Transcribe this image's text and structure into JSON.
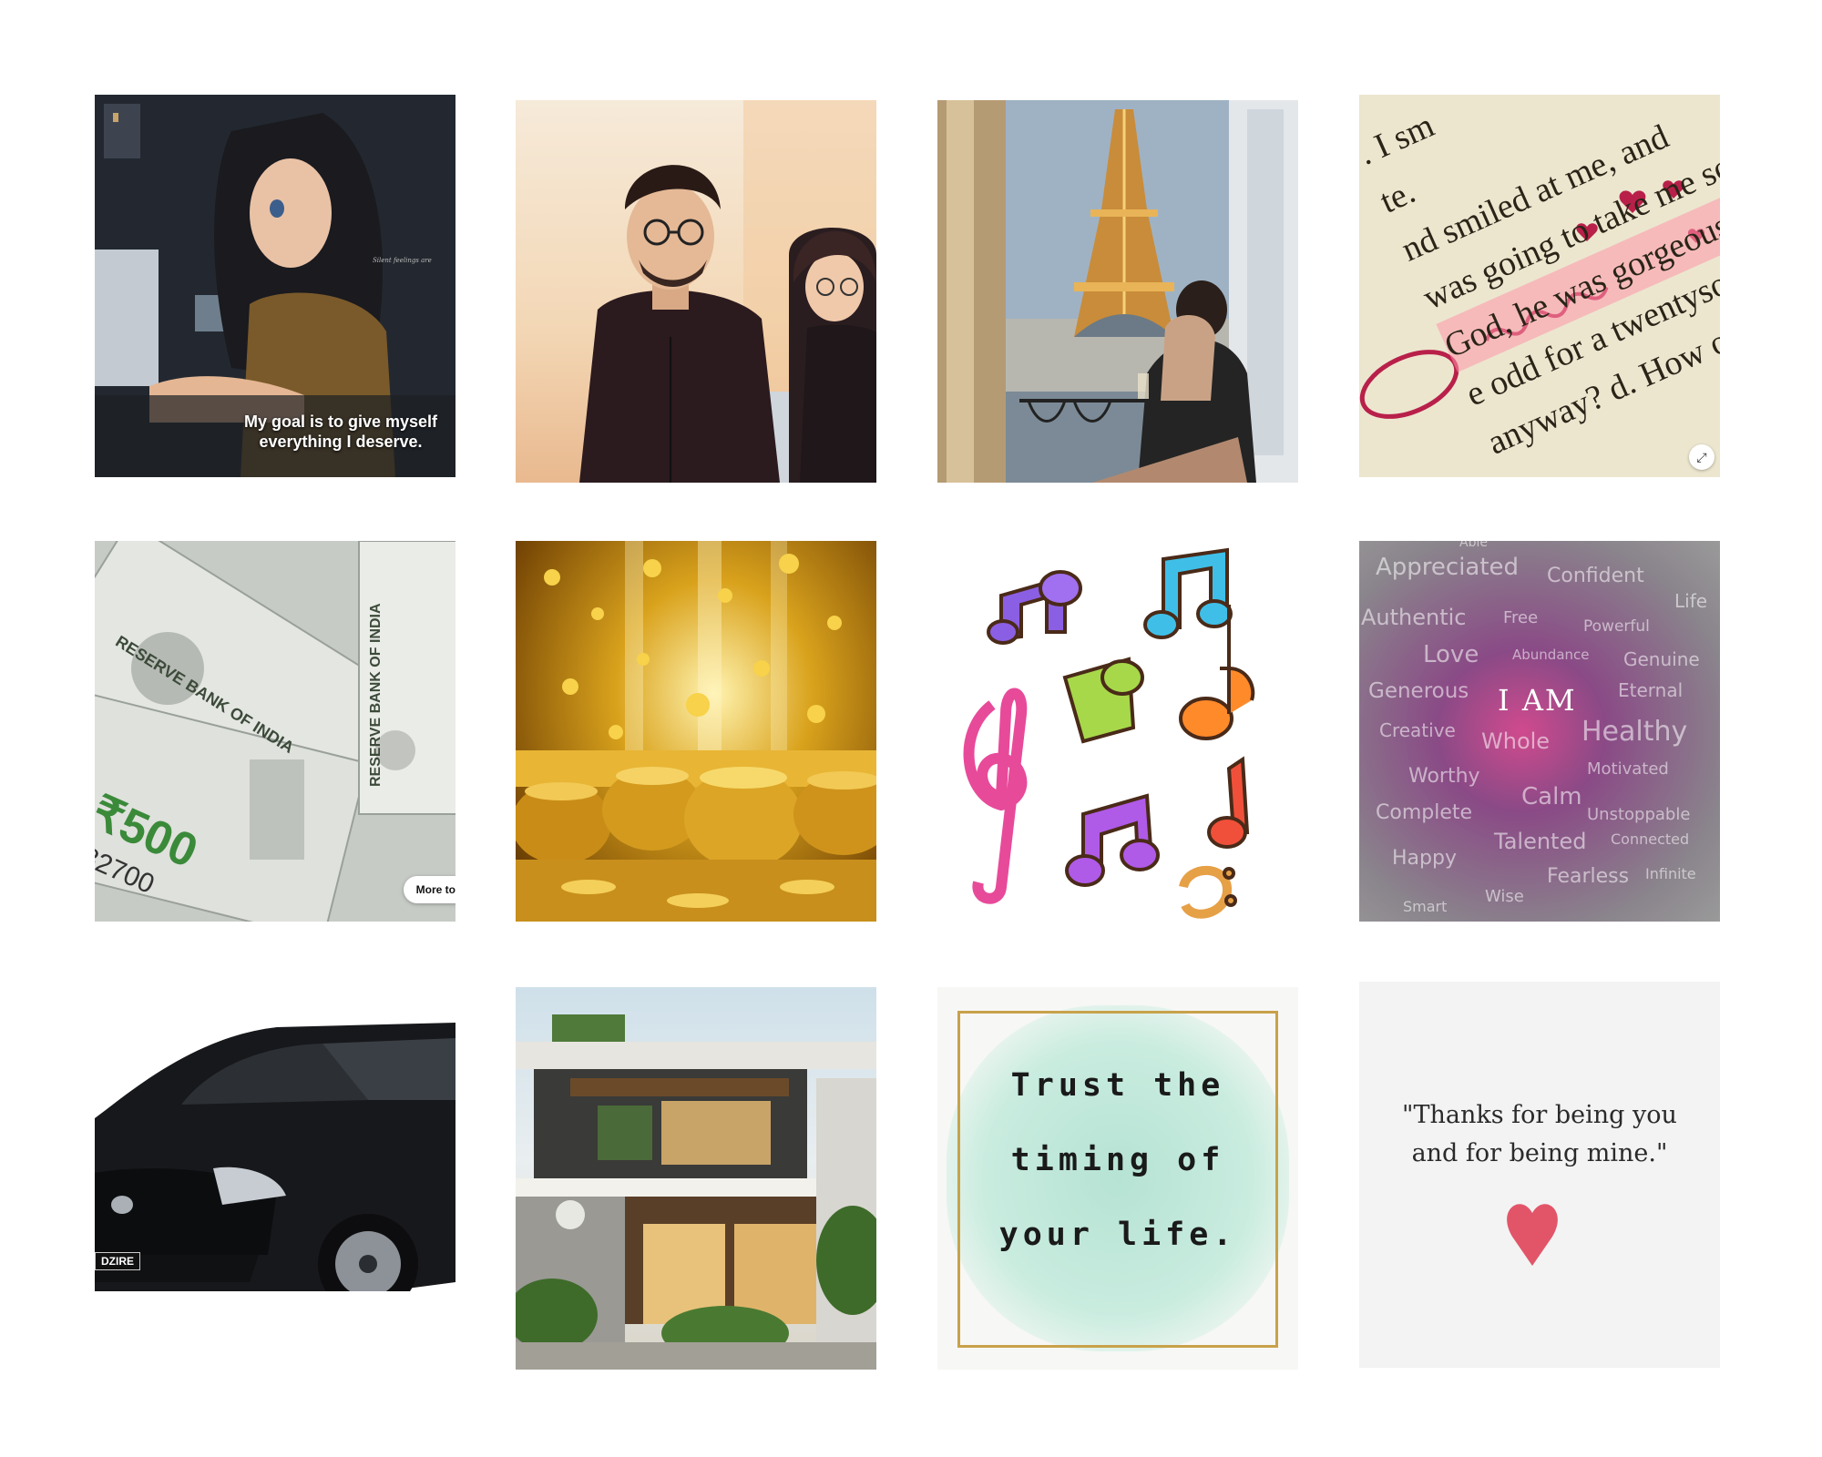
{
  "tiles": {
    "t1": {
      "caption_line1": "My goal is to give myself",
      "caption_line2": "everything I deserve.",
      "watermark": "Silent feelings are"
    },
    "t4": {
      "lines": [
        ". I sm",
        "te.",
        "nd smiled at me, and",
        "was going to take me so",
        "God, he was gorgeous.",
        "e odd for a twentysom",
        "anyway? d. How old"
      ],
      "zoom_icon": "⤢"
    },
    "t5": {
      "text_bank1": "RESERVE BANK OF INDIA",
      "text_bank2": "RESERVE BANK OF INDIA",
      "denomination": "₹500",
      "serial": "82700",
      "more_label": "More to"
    },
    "t8": {
      "center": "I AM",
      "words": [
        "Appreciated",
        "Confident",
        "Life",
        "Authentic",
        "Free",
        "Powerful",
        "Love",
        "Abundance",
        "Genuine",
        "Generous",
        "Eternal",
        "Creative",
        "Whole",
        "Healthy",
        "Worthy",
        "Motivated",
        "Calm",
        "Complete",
        "Unstoppable",
        "Talented",
        "Connected",
        "Happy",
        "Fearless",
        "Infinite",
        "Smart",
        "Wise",
        "Able"
      ]
    },
    "t9": {
      "badge": "DZIRE"
    },
    "t11": {
      "line1": "Trust the",
      "line2": "timing of",
      "line3": "your life."
    },
    "t12": {
      "line1": "\"Thanks for being you",
      "line2": "and for being mine.\""
    }
  },
  "colors": {
    "background": "#ffffff",
    "heart": "#e0445a",
    "frame_gold": "#c8a24a"
  }
}
